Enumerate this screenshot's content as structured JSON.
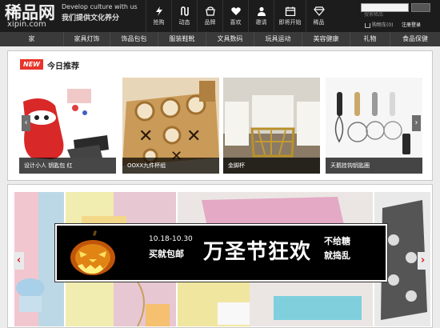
{
  "header": {
    "logo_cn": "稀品网",
    "logo_en": "xipin.com",
    "slogan_en_1": "Develop culture with us",
    "slogan_cn": "我们提供文化养分",
    "nav": [
      {
        "label": "抢购",
        "icon": "lightning-icon"
      },
      {
        "label": "动态",
        "icon": "activity-icon"
      },
      {
        "label": "品牌",
        "icon": "brand-icon"
      },
      {
        "label": "喜欢",
        "icon": "heart-icon"
      },
      {
        "label": "邀请",
        "icon": "user-icon"
      },
      {
        "label": "即将开始",
        "icon": "calendar-icon"
      },
      {
        "label": "稀品",
        "icon": "diamond-icon"
      }
    ],
    "search_placeholder": "搜索稀品",
    "cart_label": "购物车(0)",
    "login_label": "注册登录"
  },
  "categories": [
    "家",
    "家具灯饰",
    "饰品包包",
    "服装鞋靴",
    "文具数码",
    "玩具运动",
    "美容健康",
    "礼物",
    "食品保健"
  ],
  "recommend": {
    "badge": "NEW",
    "title": "今日推荐",
    "products": [
      {
        "caption": "设计小人 钥匙包 红"
      },
      {
        "caption": "OOXX九件杯组"
      },
      {
        "caption": "金脚杯"
      },
      {
        "caption": "天鹅挂钩钥匙圈"
      }
    ]
  },
  "banner": {
    "date": "10.18-10.30",
    "subtitle": "买就包邮",
    "title": "万圣节狂欢",
    "note1": "不给糖",
    "note2": "就捣乱"
  },
  "colors": {
    "header_bg": "#1c1c1c",
    "catbar_bg": "#3a3a3a",
    "accent_red": "#e8342a"
  }
}
